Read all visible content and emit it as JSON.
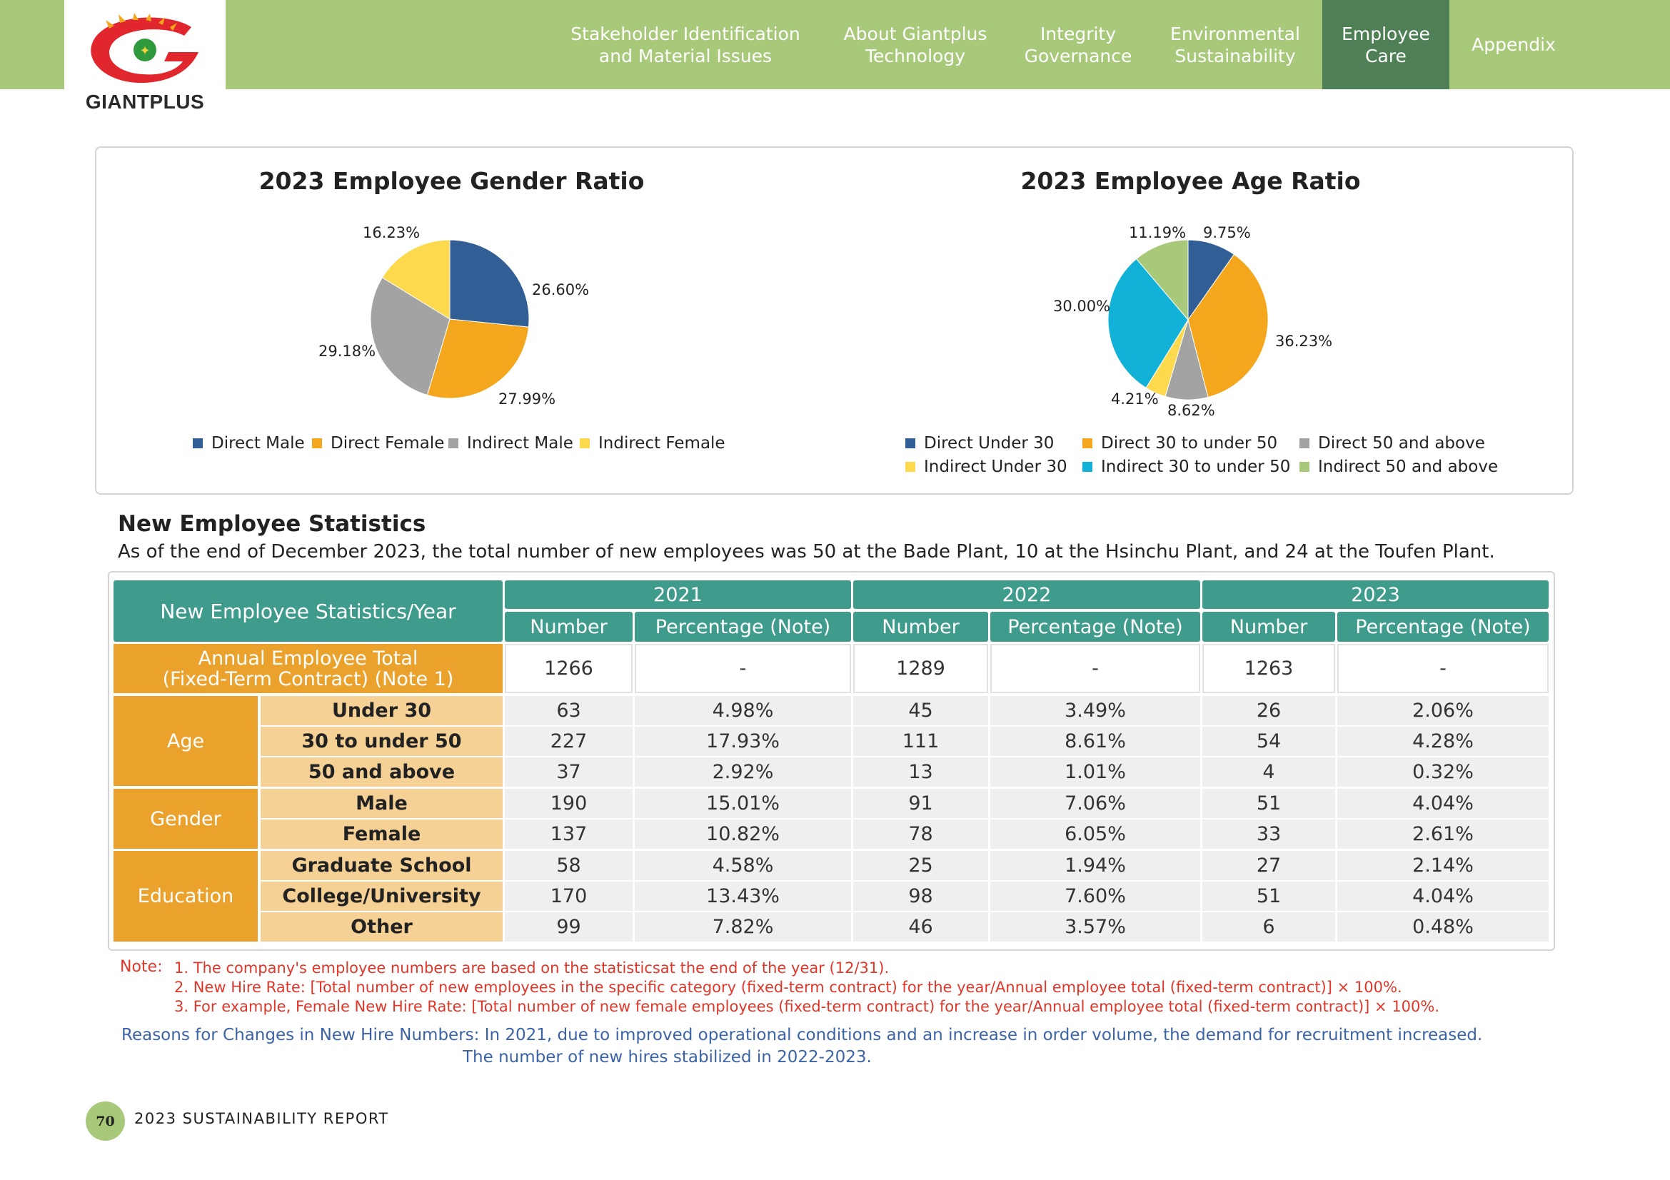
{
  "header": {
    "logo_text": "GIANTPLUS",
    "nav": [
      {
        "line1": "Stakeholder Identification",
        "line2": "and Material Issues",
        "active": false
      },
      {
        "line1": "About Giantplus",
        "line2": "Technology",
        "active": false
      },
      {
        "line1": "Integrity",
        "line2": "Governance",
        "active": false
      },
      {
        "line1": "Environmental",
        "line2": "Sustainability",
        "active": false
      },
      {
        "line1": "Employee",
        "line2": "Care",
        "active": true
      },
      {
        "line1": "Appendix",
        "line2": "",
        "active": false
      }
    ]
  },
  "colors": {
    "brand_green": "#a8c97a",
    "active_green": "#4f7f55",
    "teal": "#3f9b8c",
    "orange": "#eaa22d",
    "light_orange": "#f5d196",
    "note_red": "#e0372a",
    "reason_blue": "#3b63a6"
  },
  "chart_data": [
    {
      "type": "pie",
      "title": "2023 Employee Gender Ratio",
      "labels": [
        "Direct Male",
        "Direct Female",
        "Indirect Male",
        "Indirect Female"
      ],
      "values": [
        26.6,
        27.99,
        29.18,
        16.23
      ],
      "value_labels": [
        "26.60%",
        "27.99%",
        "29.18%",
        "16.23%"
      ],
      "colors": [
        "#325e96",
        "#f4a61d",
        "#a3a3a3",
        "#fdd94d"
      ],
      "legend_position": "bottom"
    },
    {
      "type": "pie",
      "title": "2023 Employee Age Ratio",
      "labels": [
        "Direct Under 30",
        "Direct 30 to under 50",
        "Direct 50 and above",
        "Indirect Under 30",
        "Indirect 30 to under 50",
        "Indirect 50 and above"
      ],
      "values": [
        9.75,
        36.23,
        8.62,
        4.21,
        30.0,
        11.19
      ],
      "value_labels": [
        "9.75%",
        "36.23%",
        "8.62%",
        "4.21%",
        "30.00%",
        "11.19%"
      ],
      "colors": [
        "#325e96",
        "#f4a61d",
        "#a3a3a3",
        "#fdd94d",
        "#12b2d8",
        "#a8c97a"
      ],
      "legend_position": "bottom"
    }
  ],
  "section": {
    "heading": "New Employee Statistics",
    "description": "As of the end of December 2023, the total number of new employees was 50 at the Bade Plant, 10 at the Hsinchu Plant, and 24 at the Toufen Plant."
  },
  "table": {
    "corner": "New Employee Statistics/Year",
    "years": [
      "2021",
      "2022",
      "2023"
    ],
    "col_number": "Number",
    "col_percentage": "Percentage (Note)",
    "total_label_line1": "Annual Employee Total",
    "total_label_line2": "(Fixed-Term Contract) (Note 1)",
    "total_values": [
      "1266",
      "-",
      "1289",
      "-",
      "1263",
      "-"
    ],
    "groups": [
      "Age",
      "Gender",
      "Education"
    ],
    "rows": [
      {
        "label": "Under 30",
        "values": [
          "63",
          "4.98%",
          "45",
          "3.49%",
          "26",
          "2.06%"
        ]
      },
      {
        "label": "30 to under 50",
        "values": [
          "227",
          "17.93%",
          "111",
          "8.61%",
          "54",
          "4.28%"
        ]
      },
      {
        "label": "50 and above",
        "values": [
          "37",
          "2.92%",
          "13",
          "1.01%",
          "4",
          "0.32%"
        ]
      },
      {
        "label": "Male",
        "values": [
          "190",
          "15.01%",
          "91",
          "7.06%",
          "51",
          "4.04%"
        ]
      },
      {
        "label": "Female",
        "values": [
          "137",
          "10.82%",
          "78",
          "6.05%",
          "33",
          "2.61%"
        ]
      },
      {
        "label": "Graduate School",
        "values": [
          "58",
          "4.58%",
          "25",
          "1.94%",
          "27",
          "2.14%"
        ]
      },
      {
        "label": "College/University",
        "values": [
          "170",
          "13.43%",
          "98",
          "7.60%",
          "51",
          "4.04%"
        ]
      },
      {
        "label": "Other",
        "values": [
          "99",
          "7.82%",
          "46",
          "3.57%",
          "6",
          "0.48%"
        ]
      }
    ]
  },
  "notes": {
    "label": "Note:",
    "items": [
      "1. The company's employee numbers are based on the statisticsat the end of the year (12/31).",
      "2. New Hire Rate: [Total number of new employees in the specific category (fixed-term contract) for the year/Annual employee total (fixed-term contract)] × 100%.",
      "3. For example, Female New Hire Rate: [Total number of new female employees (fixed-term contract) for the year/Annual employee total (fixed-term contract)] × 100%."
    ],
    "reason_line1": "Reasons for Changes in New Hire Numbers: In 2021, due to improved operational conditions and an increase in order volume, the demand for recruitment increased.",
    "reason_line2": "The number of new hires stabilized in 2022-2023."
  },
  "footer": {
    "page_number": "70",
    "report": "2023 SUSTAINABILITY REPORT"
  }
}
